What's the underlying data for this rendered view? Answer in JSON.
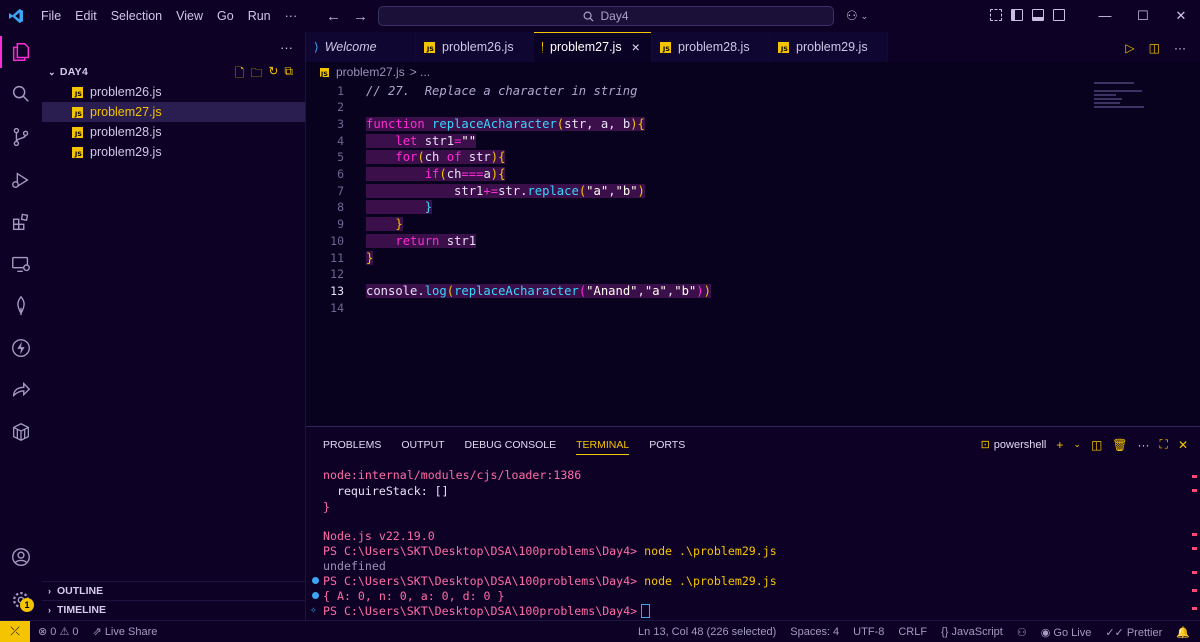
{
  "menu": [
    "File",
    "Edit",
    "Selection",
    "View",
    "Go",
    "Run",
    "···"
  ],
  "search": {
    "text": "Day4"
  },
  "window_controls": {
    "minimize": "—",
    "maximize": "☐",
    "close": "✕"
  },
  "sidebar": {
    "header_more": "···",
    "folder": "DAY4",
    "files": [
      {
        "name": "problem26.js",
        "selected": false
      },
      {
        "name": "problem27.js",
        "selected": true
      },
      {
        "name": "problem28.js",
        "selected": false
      },
      {
        "name": "problem29.js",
        "selected": false
      }
    ],
    "outline": "OUTLINE",
    "timeline": "TIMELINE"
  },
  "tabs": [
    {
      "label": "Welcome",
      "icon": "vscode-icon",
      "active": false
    },
    {
      "label": "problem26.js",
      "icon": "js-icon",
      "active": false
    },
    {
      "label": "problem27.js",
      "icon": "js-icon",
      "active": true
    },
    {
      "label": "problem28.js",
      "icon": "js-icon",
      "active": false
    },
    {
      "label": "problem29.js",
      "icon": "js-icon",
      "active": false
    }
  ],
  "breadcrumb": {
    "file": "problem27.js",
    "rest": "> ..."
  },
  "editor": {
    "current_line": 13,
    "line_numbers": [
      "1",
      "2",
      "3",
      "4",
      "5",
      "6",
      "7",
      "8",
      "9",
      "10",
      "11",
      "12",
      "13",
      "14"
    ]
  },
  "panel": {
    "tabs": [
      "PROBLEMS",
      "OUTPUT",
      "DEBUG CONSOLE",
      "TERMINAL",
      "PORTS"
    ],
    "active_tab": "TERMINAL",
    "shell": "powershell",
    "terminal": {
      "l1": "node:internal/modules/cjs/loader:1386",
      "l2": "  requireStack: []",
      "l3": "}",
      "l4": "Node.js v22.19.0",
      "l5_prompt": "PS C:\\Users\\SKT\\Desktop\\DSA\\100problems\\Day4>",
      "l5_cmd": "node .\\problem29.js",
      "l6": "undefined",
      "l7_prompt": "PS C:\\Users\\SKT\\Desktop\\DSA\\100problems\\Day4>",
      "l7_cmd": "node .\\problem29.js",
      "l8": "{ A: 0, n: 0, a: 0, d: 0 }",
      "l9_prompt": "PS C:\\Users\\SKT\\Desktop\\DSA\\100problems\\Day4>"
    }
  },
  "statusbar": {
    "errors": "0",
    "warnings": "0",
    "live_share": "Live Share",
    "position": "Ln 13, Col 48 (226 selected)",
    "spaces": "Spaces: 4",
    "encoding": "UTF-8",
    "eol": "CRLF",
    "language": "JavaScript",
    "go_live": "Go Live",
    "prettier": "Prettier"
  },
  "accounts_badge": "1"
}
